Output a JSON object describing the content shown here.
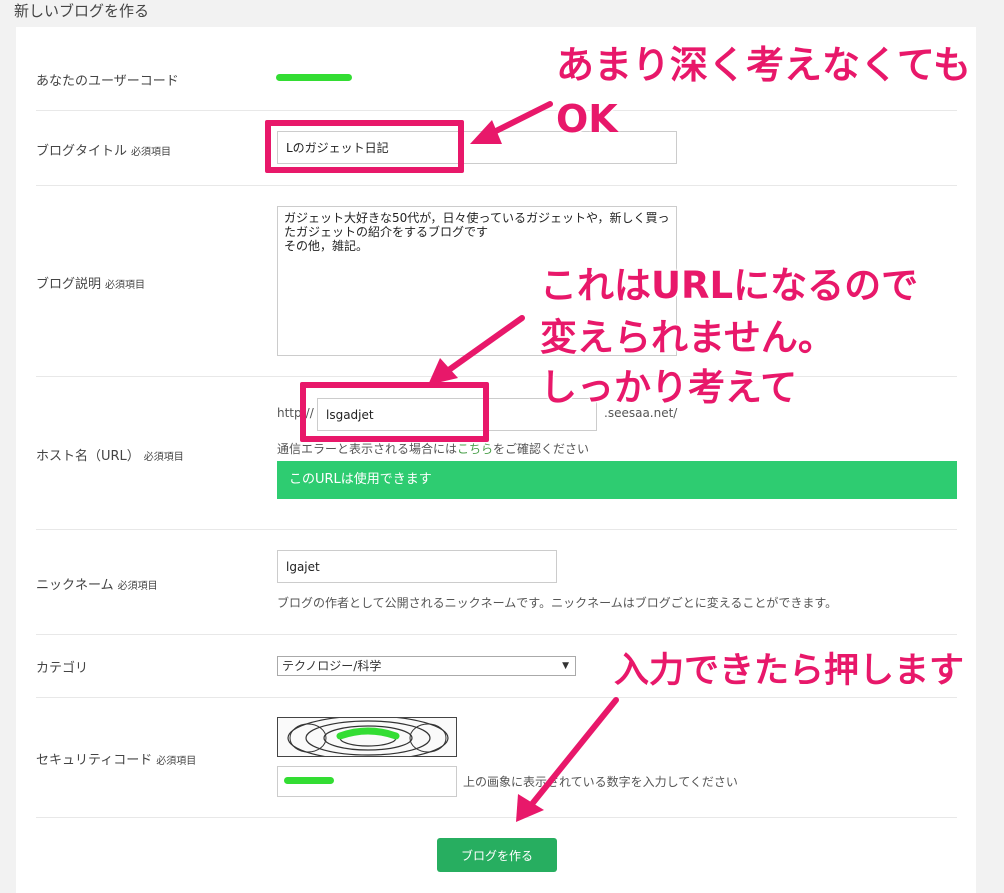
{
  "page": {
    "title": "新しいブログを作る"
  },
  "required_mark": "必須項目",
  "usercode": {
    "label": "あなたのユーザーコード"
  },
  "blog_title": {
    "label": "ブログタイトル",
    "value": "Lのガジェット日記"
  },
  "blog_desc": {
    "label": "ブログ説明",
    "value": "ガジェット大好きな50代が，日々使っているガジェットや，新しく買ったガジェットの紹介をするブログです\nその他，雑記。"
  },
  "host": {
    "label": "ホスト名（URL）",
    "prefix": "http://",
    "value": "lsgadjet",
    "suffix": ".seesaa.net/",
    "note_before": "通信エラーと表示される場合には",
    "note_link": "こちら",
    "note_after": "をご確認ください",
    "status": "このURLは使用できます"
  },
  "nickname": {
    "label": "ニックネーム",
    "value": "lgajet",
    "help": "ブログの作者として公開されるニックネームです。ニックネームはブログごとに変えることができます。"
  },
  "category": {
    "label": "カテゴリ",
    "selected": "テクノロジー/科学"
  },
  "security": {
    "label": "セキュリティコード",
    "help": "上の画象に表示されている数字を入力してください"
  },
  "submit": {
    "label": "ブログを作る"
  },
  "annotations": {
    "title_note_1": "あまり深く考えなくても",
    "title_note_2": "OK",
    "url_note_1": "これはURLになるので",
    "url_note_2": "変えられません。",
    "url_note_3": "しっかり考えて",
    "submit_note": "入力できたら押します"
  },
  "colors": {
    "accent_annotation": "#e8186a",
    "success": "#2ecc71",
    "button": "#27ae60",
    "redaction": "#33dd33"
  }
}
